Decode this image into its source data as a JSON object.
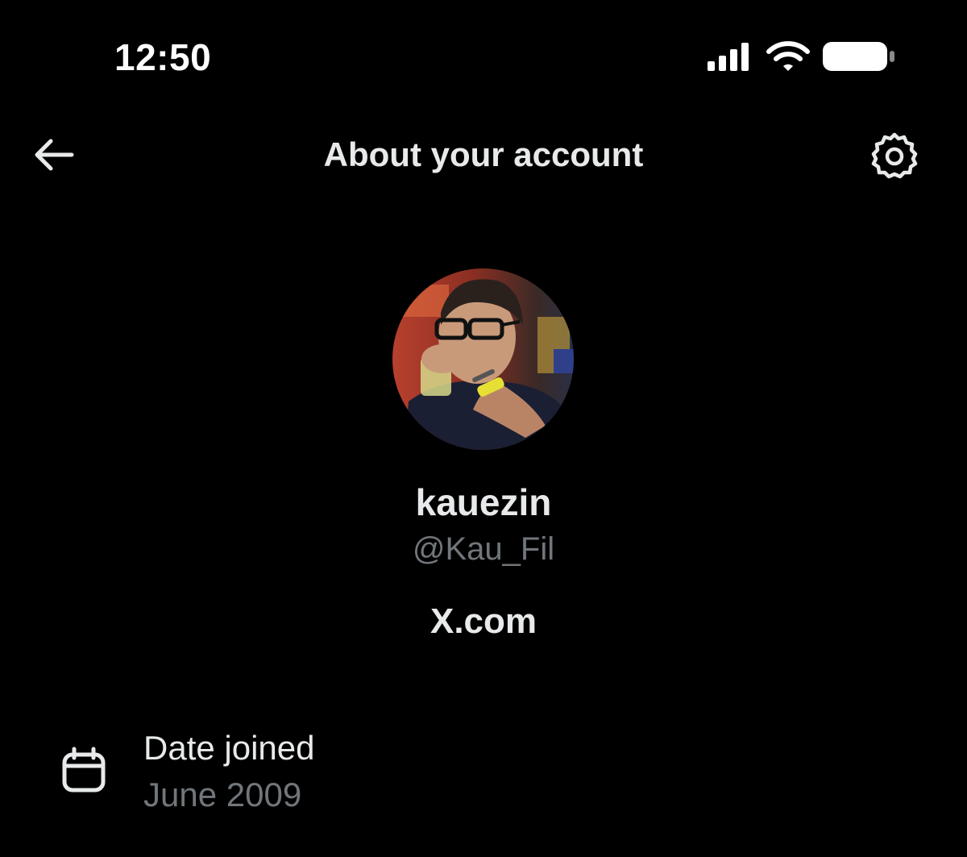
{
  "status_bar": {
    "time": "12:50",
    "icons": [
      "cellular-signal-icon",
      "wifi-icon",
      "battery-icon"
    ]
  },
  "header": {
    "title": "About your account",
    "back_icon": "arrow-left-icon",
    "settings_icon": "gear-icon"
  },
  "profile": {
    "display_name": "kauezin",
    "handle": "@Kau_Fil",
    "site": "X.com"
  },
  "details": {
    "date_joined": {
      "label": "Date joined",
      "value": "June 2009",
      "icon": "calendar-icon"
    }
  },
  "colors": {
    "background": "#000000",
    "primary_text": "#e7e9ea",
    "secondary_text": "#71767b"
  }
}
